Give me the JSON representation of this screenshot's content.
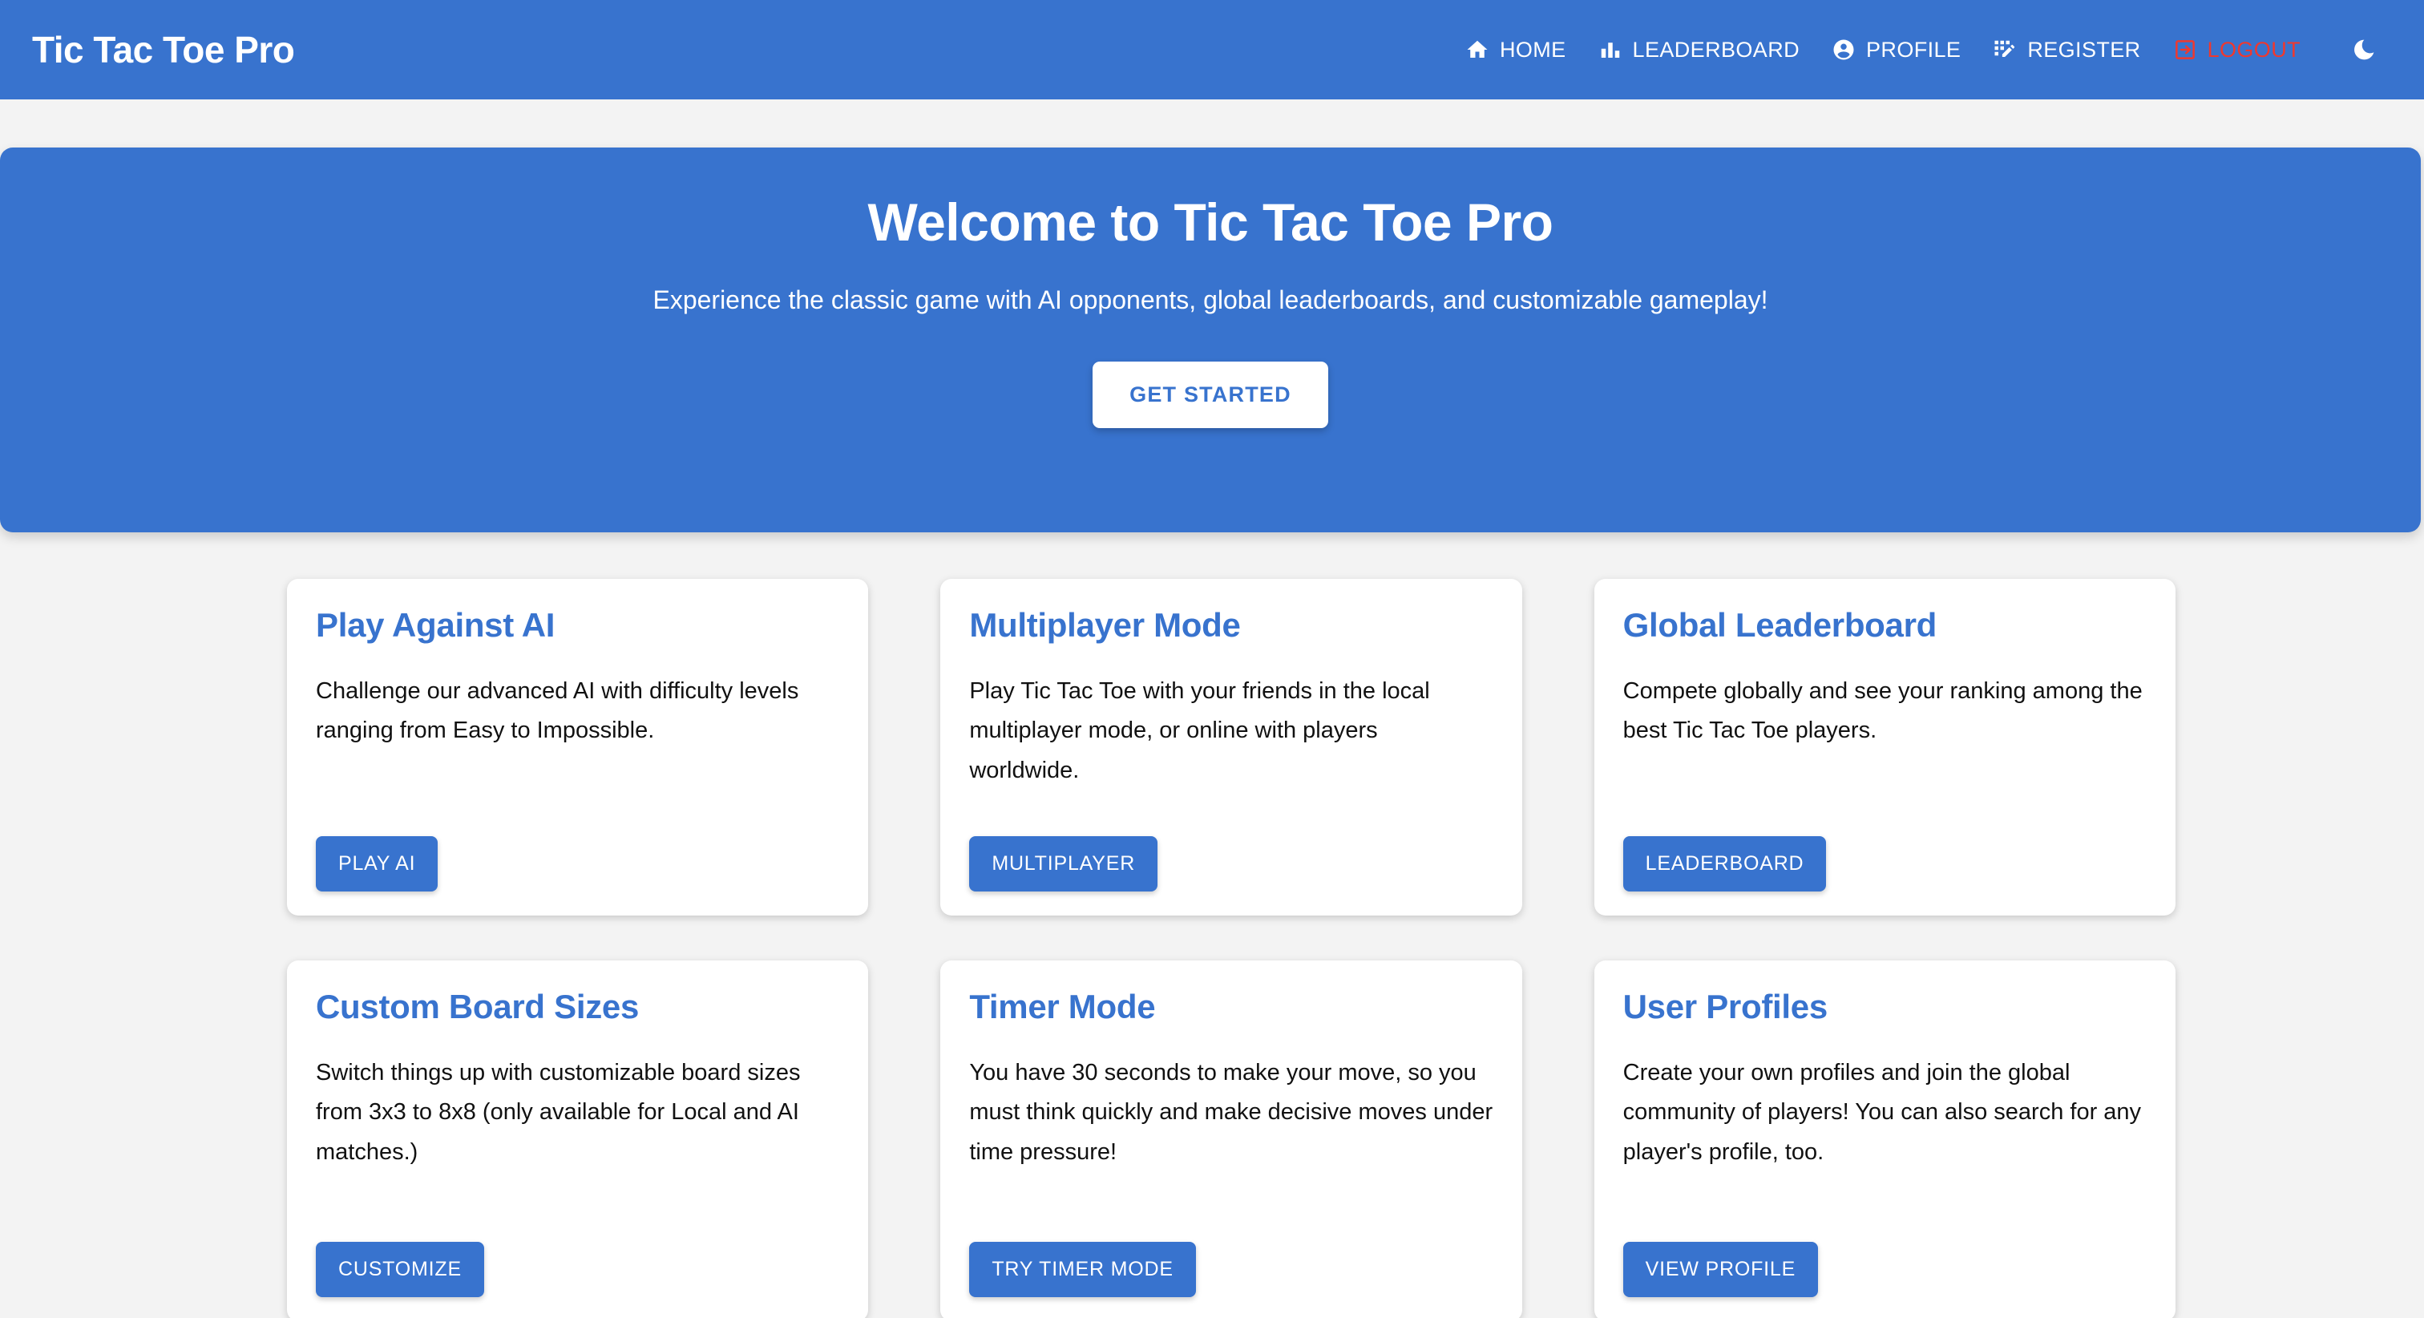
{
  "brand": {
    "title": "Tic Tac Toe Pro"
  },
  "nav": {
    "items": [
      {
        "label": "HOME",
        "icon": "home-icon"
      },
      {
        "label": "LEADERBOARD",
        "icon": "bar-chart-icon"
      },
      {
        "label": "PROFILE",
        "icon": "account-circle-icon"
      },
      {
        "label": "REGISTER",
        "icon": "app-registration-icon"
      },
      {
        "label": "LOGOUT",
        "icon": "logout-icon"
      }
    ],
    "theme_toggle": {
      "icon": "moon-icon"
    },
    "logout_color": "#f0382e"
  },
  "hero": {
    "title": "Welcome to Tic Tac Toe Pro",
    "subtitle": "Experience the classic game with AI opponents, global leaderboards, and customizable gameplay!",
    "cta_label": "GET STARTED"
  },
  "cards": [
    {
      "title": "Play Against AI",
      "text": "Challenge our advanced AI with difficulty levels ranging from Easy to Impossible.",
      "button": "PLAY AI"
    },
    {
      "title": "Multiplayer Mode",
      "text": "Play Tic Tac Toe with your friends in the local multiplayer mode, or online with players worldwide.",
      "button": "MULTIPLAYER"
    },
    {
      "title": "Global Leaderboard",
      "text": "Compete globally and see your ranking among the best Tic Tac Toe players.",
      "button": "LEADERBOARD"
    },
    {
      "title": "Custom Board Sizes",
      "text": "Switch things up with customizable board sizes from 3x3 to 8x8 (only available for Local and AI matches.)",
      "button": "CUSTOMIZE"
    },
    {
      "title": "Timer Mode",
      "text": "You have 30 seconds to make your move, so you must think quickly and make decisive moves under time pressure!",
      "button": "TRY TIMER MODE"
    },
    {
      "title": "User Profiles",
      "text": "Create your own profiles and join the global community of players! You can also search for any player's profile, too.",
      "button": "VIEW PROFILE"
    }
  ],
  "colors": {
    "primary": "#3873ce",
    "danger": "#f0382e",
    "page_bg": "#f3f3f3",
    "card_bg": "#ffffff"
  }
}
